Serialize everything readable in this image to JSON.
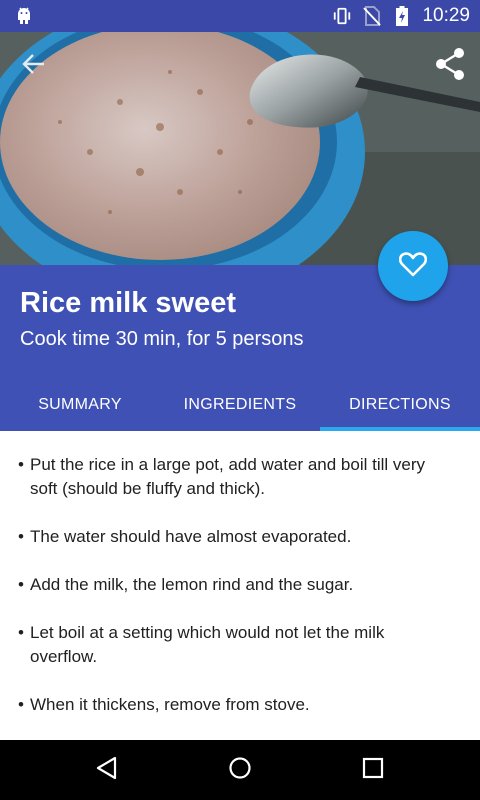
{
  "status_bar": {
    "time": "10:29",
    "left_icons": [
      "android-debug-icon"
    ],
    "right_icons": [
      "vibrate-icon",
      "no-sim-icon",
      "battery-charging-icon"
    ]
  },
  "hero": {
    "image": "rice-pudding-bowl-photo",
    "back_icon": "arrow-back-icon",
    "share_icon": "share-icon"
  },
  "fab": {
    "icon": "heart-outline-icon"
  },
  "recipe": {
    "title": "Rice milk sweet",
    "subtitle": "Cook time 30 min, for 5 persons"
  },
  "tabs": [
    {
      "label": "SUMMARY",
      "active": false
    },
    {
      "label": "INGREDIENTS",
      "active": false
    },
    {
      "label": "DIRECTIONS",
      "active": true
    }
  ],
  "directions": [
    "Put the rice in a large pot, add water and boil till very soft (should be fluffy and thick).",
    "The water should have almost evaporated.",
    "Add the milk, the lemon rind and the sugar.",
    "Let boil at a setting which would not let the milk overflow.",
    "When it thickens, remove from stove."
  ],
  "bullet": "•",
  "colors": {
    "primary": "#3f51b5",
    "status_bar": "#3c48a8",
    "accent": "#1fa3ea",
    "tab_indicator": "#2aa9f0"
  },
  "nav_bar": [
    "back-triangle-icon",
    "home-circle-icon",
    "recents-square-icon"
  ]
}
